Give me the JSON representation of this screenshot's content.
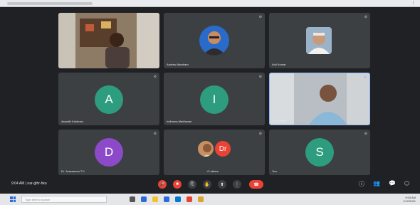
{
  "participants": [
    {
      "name": "",
      "mic": "⊘"
    },
    {
      "name": "Andrew Abraham",
      "mic": "⊘"
    },
    {
      "name": "Anil Kumar",
      "mic": "⊘"
    },
    {
      "name": "Aswathi Krishnan",
      "initial": "A",
      "color": "#2e9c7e",
      "mic": "⊘"
    },
    {
      "name": "Indhuma Madhavan",
      "initial": "I",
      "color": "#2e9c7e",
      "mic": "⊘"
    },
    {
      "name": "Dr. Geetha",
      "mic": "⊘"
    },
    {
      "name": "Dr. Jeasamma T K",
      "initial": "D",
      "color": "#8c4ac8",
      "mic": "⊘"
    },
    {
      "name": "+2 others",
      "initial": "Dr",
      "color": "#ea4335",
      "mic": "⊘"
    },
    {
      "name": "You",
      "initial": "S",
      "color": "#2e9c7e",
      "mic": "⊘"
    }
  ],
  "toolbar": {
    "meeting_info": "9:04 AM  |  oar-gthr-hku",
    "buttons": {
      "mic": "🎤",
      "camera": "■",
      "captions": "⎘",
      "present": "⬆",
      "raise_hand": "✋",
      "more": "⋮",
      "end": "☎"
    },
    "right": {
      "info": "ⓘ",
      "people": "👥",
      "chat": "💬",
      "activities": "⬡"
    }
  },
  "taskbar": {
    "search_placeholder": "Type here to search",
    "time": "9:04 AM",
    "date": "1/12/2021"
  }
}
